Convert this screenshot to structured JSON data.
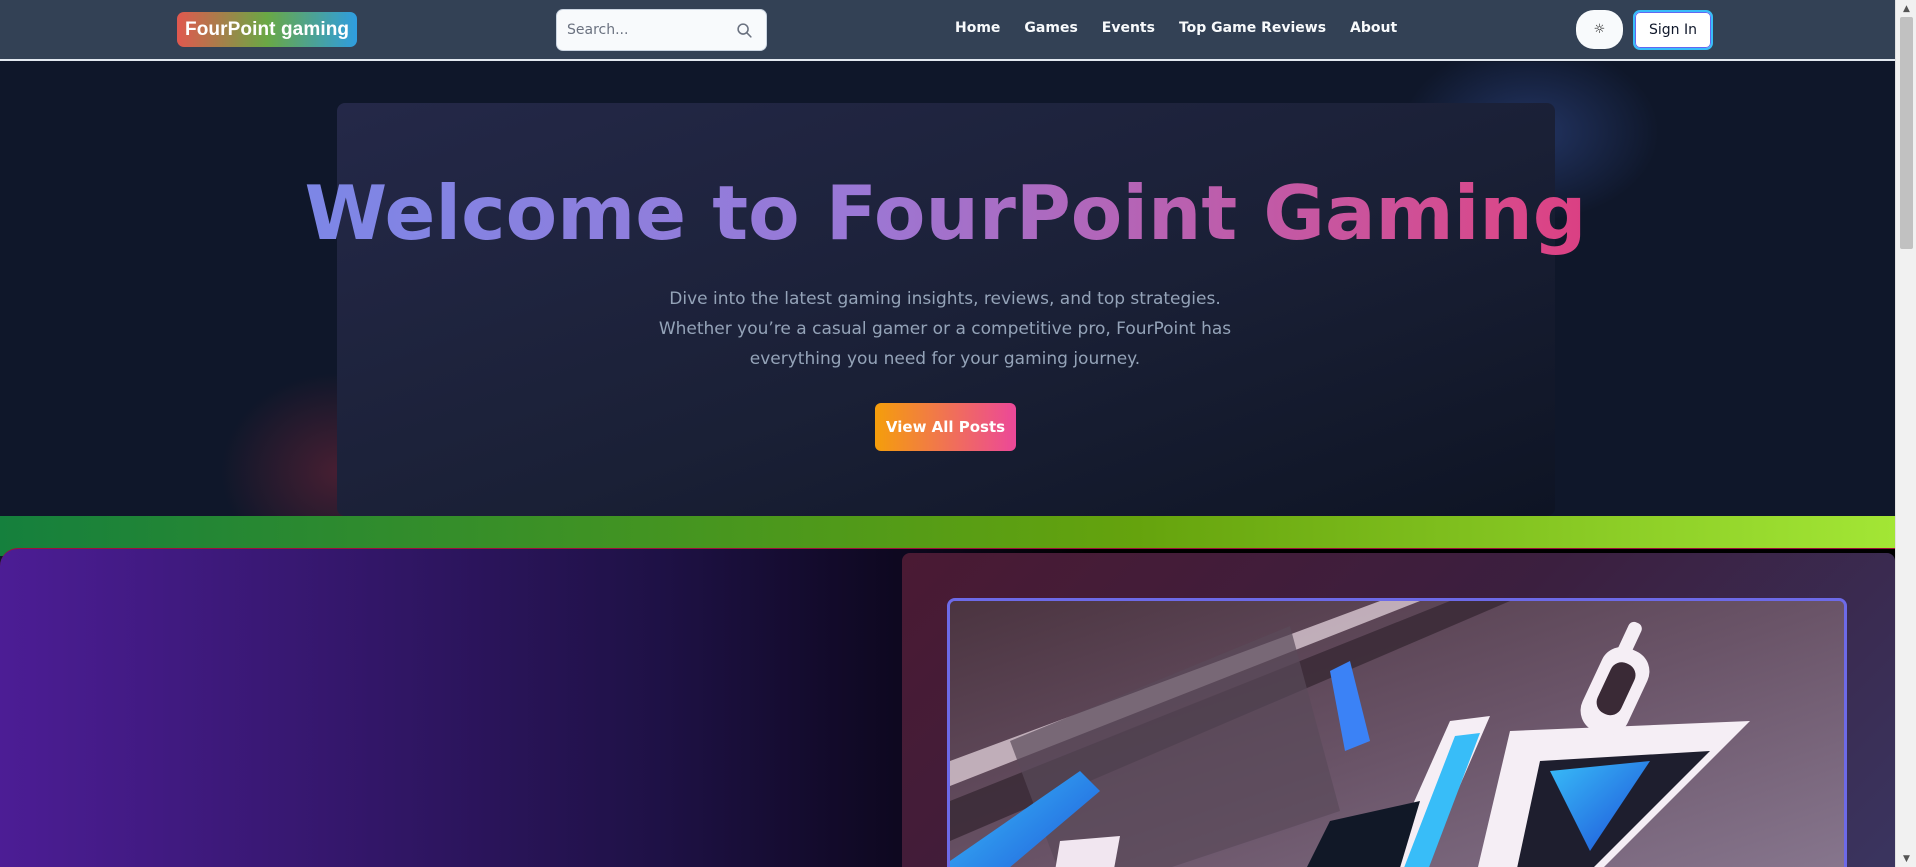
{
  "header": {
    "logo_text": "FourPoint gaming",
    "search": {
      "placeholder": "Search..."
    },
    "nav": [
      "Home",
      "Games",
      "Events",
      "Top Game Reviews",
      "About"
    ],
    "theme_toggle_symbol": "☼",
    "sign_in_label": "Sign In"
  },
  "hero": {
    "title": "Welcome to FourPoint Gaming",
    "description": "Dive into the latest gaming insights, reviews, and top strategies. Whether you’re a casual gamer or a competitive pro, FourPoint has everything you need for your gaming journey.",
    "cta_label": "View All Posts"
  },
  "colors": {
    "navbar_bg": "#334155",
    "hero_bg": "#0f172a",
    "cta_gradient_start": "#f59e0b",
    "cta_gradient_end": "#ec4899",
    "title_gradient_start": "#6c8ff0",
    "title_gradient_end": "#e11d63"
  },
  "icons": {
    "search": "search-icon",
    "theme": "sun-icon"
  }
}
